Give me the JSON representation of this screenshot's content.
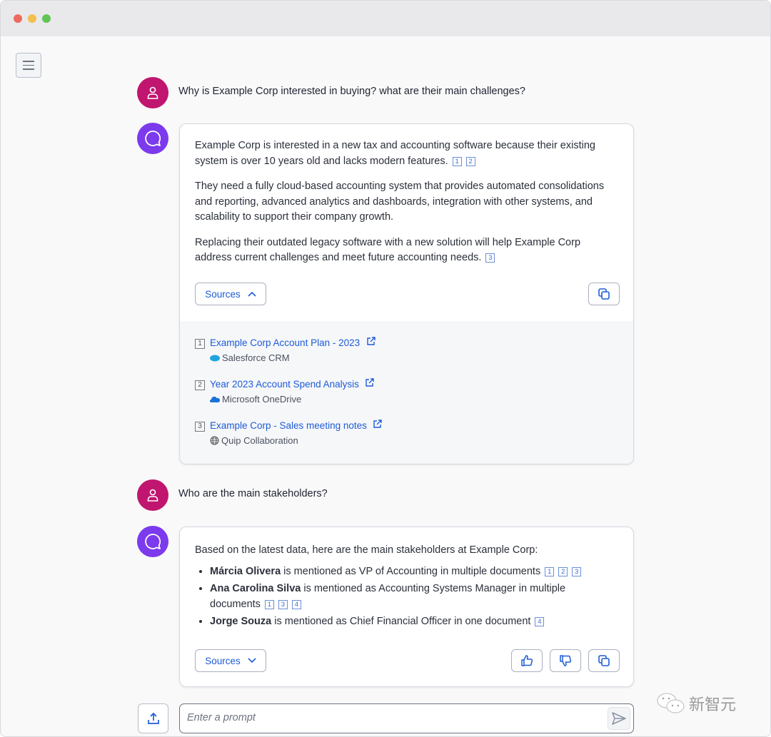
{
  "menu": {
    "icon": "hamburger-icon"
  },
  "conversation": [
    {
      "question": "Why is Example Corp interested in buying? what are their main challenges?",
      "answer": {
        "paragraphs": [
          {
            "text": "Example Corp is interested in a new tax and accounting software because their existing system is over 10 years old and lacks modern features.",
            "cites": [
              "1",
              "2"
            ]
          },
          {
            "text": "They need a fully cloud-based accounting system that provides automated consolidations and reporting, advanced analytics and dashboards, integration with other systems, and scalability to support their company growth.",
            "cites": []
          },
          {
            "text": "Replacing their outdated legacy software with a new solution will help Example Corp address current challenges and meet future accounting needs.",
            "cites": [
              "3"
            ]
          }
        ],
        "sources_label": "Sources",
        "sources": [
          {
            "num": "1",
            "title": "Example Corp Account Plan - 2023",
            "origin": "Salesforce CRM",
            "icon": "salesforce-icon"
          },
          {
            "num": "2",
            "title": "Year 2023 Account Spend Analysis",
            "origin": "Microsoft OneDrive",
            "icon": "onedrive-icon"
          },
          {
            "num": "3",
            "title": "Example Corp - Sales meeting notes",
            "origin": "Quip Collaboration",
            "icon": "globe-icon"
          }
        ]
      }
    },
    {
      "question": "Who are the main stakeholders?",
      "answer": {
        "intro": "Based on the latest data, here are the main stakeholders at Example Corp:",
        "bullets": [
          {
            "name": "Márcia Olivera",
            "text": " is mentioned as VP of Accounting in multiple documents",
            "cites": [
              "1",
              "2",
              "3"
            ]
          },
          {
            "name": "Ana Carolina Silva",
            "text": " is mentioned as Accounting Systems Manager in multiple documents",
            "cites": [
              "1",
              "3",
              "4"
            ]
          },
          {
            "name": "Jorge Souza",
            "text": " is mentioned as Chief Financial Officer in one document",
            "cites": [
              "4"
            ]
          }
        ],
        "sources_label": "Sources"
      }
    }
  ],
  "prompt": {
    "placeholder": "Enter a prompt"
  },
  "watermark": "新智元",
  "colors": {
    "user_avatar": "#c0166f",
    "bot_avatar": "#7c3aed",
    "accent": "#1d5bd8"
  }
}
